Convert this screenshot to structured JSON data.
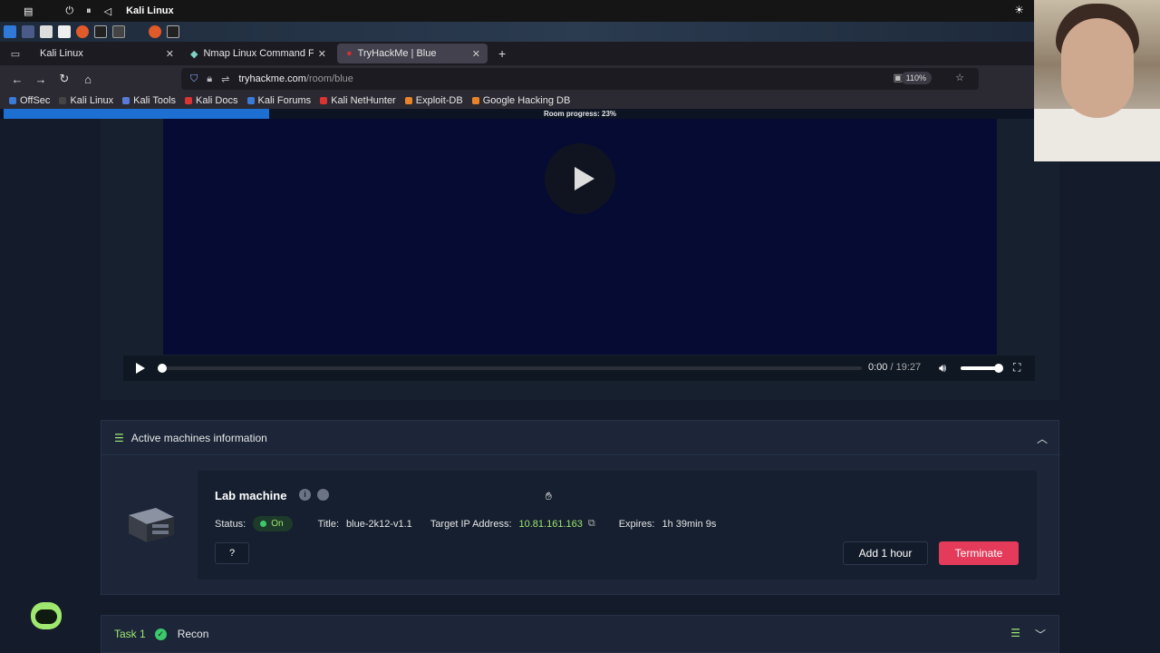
{
  "os": {
    "title": "Kali Linux"
  },
  "browser": {
    "tabs": [
      {
        "label": "Kali Linux"
      },
      {
        "label": "Nmap Linux Command For"
      },
      {
        "label": "TryHackMe | Blue"
      }
    ],
    "new_tab": "+",
    "url_host": "tryhackme.com",
    "url_path": "/room/blue",
    "zoom": "110%"
  },
  "bookmarks": [
    {
      "label": "OffSec",
      "color": "#3a7bd5"
    },
    {
      "label": "Kali Linux",
      "color": "#444"
    },
    {
      "label": "Kali Tools",
      "color": "#5a7bd5"
    },
    {
      "label": "Kali Docs",
      "color": "#d33"
    },
    {
      "label": "Kali Forums",
      "color": "#3a7bd5"
    },
    {
      "label": "Kali NetHunter",
      "color": "#d33"
    },
    {
      "label": "Exploit-DB",
      "color": "#e8832a"
    },
    {
      "label": "Google Hacking DB",
      "color": "#e8832a"
    }
  ],
  "room_progress": {
    "label": "Room progress: 23%",
    "percent": 23
  },
  "video": {
    "current": "0:00",
    "duration": "/ 19:27"
  },
  "active_machines": {
    "header": "Active machines information",
    "lab_title": "Lab machine",
    "status_label": "Status:",
    "status_value": "On",
    "title_label": "Title:",
    "title_value": "blue-2k12-v1.1",
    "ip_label": "Target IP Address:",
    "ip_value": "10.81.161.163",
    "expires_label": "Expires:",
    "expires_value": "1h 39min 9s",
    "help_label": "?",
    "add_hour_label": "Add 1 hour",
    "terminate_label": "Terminate"
  },
  "task": {
    "number": "Task 1",
    "name": "Recon"
  },
  "colors": {
    "accent_green": "#9fe870",
    "terminate_red": "#e43b5a",
    "progress_blue": "#1e6fd2"
  }
}
